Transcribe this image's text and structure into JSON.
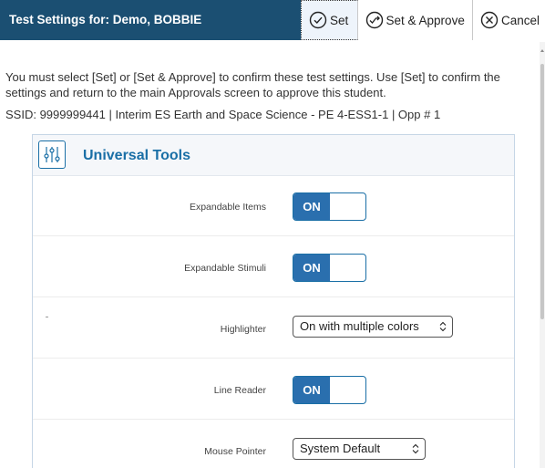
{
  "header": {
    "title": "Test Settings for: Demo, BOBBIE",
    "buttons": {
      "set": "Set",
      "set_approve": "Set & Approve",
      "cancel": "Cancel"
    }
  },
  "notice": "You must select [Set] or [Set & Approve] to confirm these test settings. Use [Set] to confirm the settings and return to the main Approvals screen to approve this student.",
  "ssid_line": "SSID: 9999999441 | Interim ES Earth and Space Science - PE 4-ESS1-1 | Opp # 1",
  "panel": {
    "title": "Universal Tools",
    "settings": [
      {
        "label": "Expandable Items",
        "type": "toggle",
        "value": "ON"
      },
      {
        "label": "Expandable Stimuli",
        "type": "toggle",
        "value": "ON"
      },
      {
        "label": "Highlighter",
        "type": "select",
        "value": "On with multiple colors"
      },
      {
        "label": "Line Reader",
        "type": "toggle",
        "value": "ON"
      },
      {
        "label": "Mouse Pointer",
        "type": "select",
        "value": "System Default"
      }
    ]
  },
  "colors": {
    "header_bg": "#1b4f72",
    "accent": "#1a6fa6",
    "toggle_on": "#2a6fae"
  }
}
